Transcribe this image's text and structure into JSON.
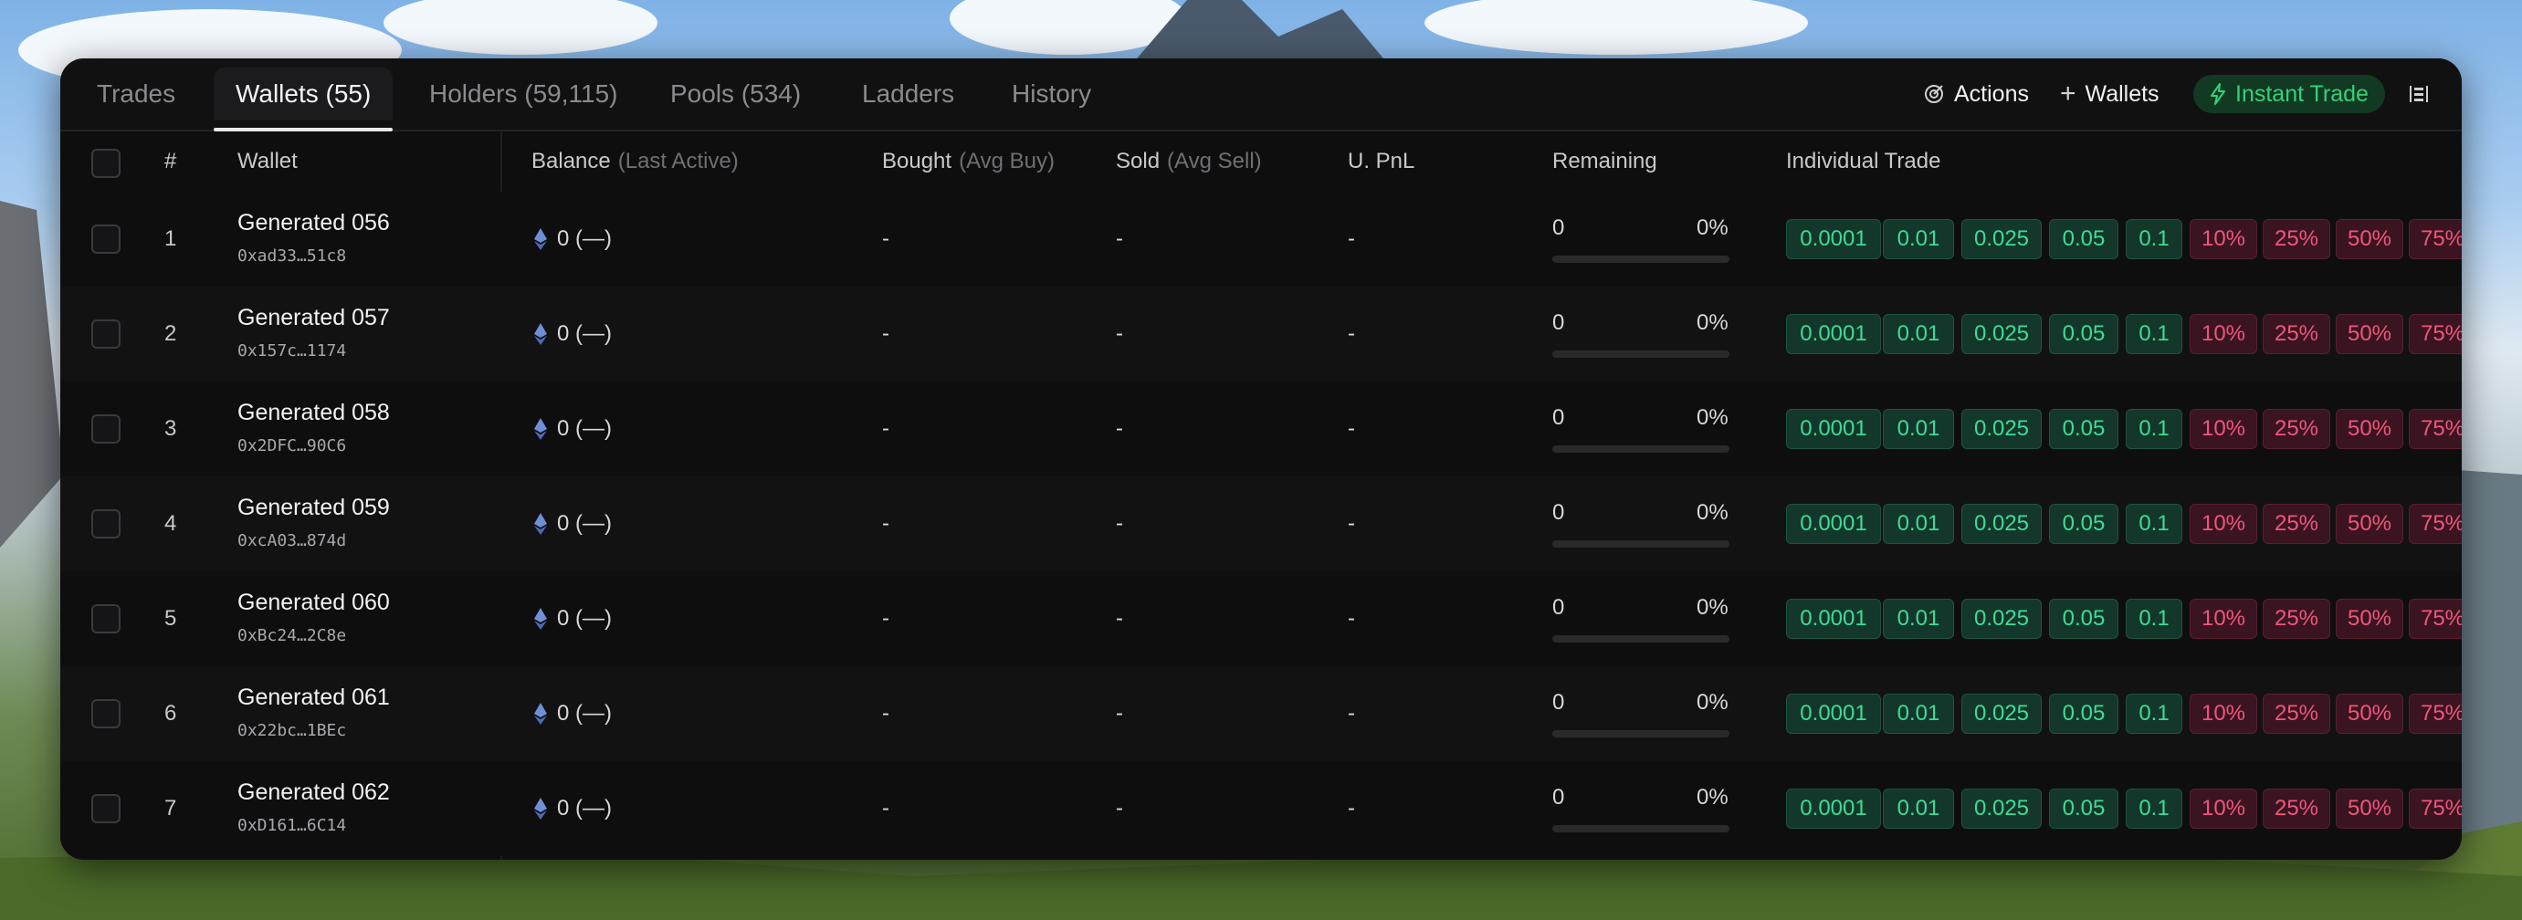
{
  "tabs": [
    {
      "label": "Trades"
    },
    {
      "label": "Wallets (55)"
    },
    {
      "label": "Holders (59,115)"
    },
    {
      "label": "Pools (534)"
    },
    {
      "label": "Ladders"
    },
    {
      "label": "History"
    }
  ],
  "active_tab": "Wallets (55)",
  "toolbar": {
    "actions_label": "Actions",
    "wallets_label": "Wallets",
    "instant_trade_label": "Instant Trade"
  },
  "columns": {
    "index": "#",
    "wallet": "Wallet",
    "balance": "Balance",
    "balance_sub": "(Last Active)",
    "bought": "Bought",
    "bought_sub": "(Avg Buy)",
    "sold": "Sold",
    "sold_sub": "(Avg Sell)",
    "upnl": "U. PnL",
    "remaining": "Remaining",
    "individual_trade": "Individual Trade"
  },
  "buy_amounts": [
    "0.0001",
    "0.01",
    "0.025",
    "0.05",
    "0.1"
  ],
  "sell_percents": [
    "10%",
    "25%",
    "50%",
    "75%"
  ],
  "rows": [
    {
      "index": "1",
      "name": "Generated 056",
      "address": "0xad33…51c8",
      "balance": "0 (—)",
      "bought": "-",
      "sold": "-",
      "upnl": "-",
      "remaining": "0",
      "remaining_pct": "0%",
      "remaining_fraction": 0
    },
    {
      "index": "2",
      "name": "Generated 057",
      "address": "0x157c…1174",
      "balance": "0 (—)",
      "bought": "-",
      "sold": "-",
      "upnl": "-",
      "remaining": "0",
      "remaining_pct": "0%",
      "remaining_fraction": 0
    },
    {
      "index": "3",
      "name": "Generated 058",
      "address": "0x2DFC…90C6",
      "balance": "0 (—)",
      "bought": "-",
      "sold": "-",
      "upnl": "-",
      "remaining": "0",
      "remaining_pct": "0%",
      "remaining_fraction": 0
    },
    {
      "index": "4",
      "name": "Generated 059",
      "address": "0xcA03…874d",
      "balance": "0 (—)",
      "bought": "-",
      "sold": "-",
      "upnl": "-",
      "remaining": "0",
      "remaining_pct": "0%",
      "remaining_fraction": 0
    },
    {
      "index": "5",
      "name": "Generated 060",
      "address": "0xBc24…2C8e",
      "balance": "0 (—)",
      "bought": "-",
      "sold": "-",
      "upnl": "-",
      "remaining": "0",
      "remaining_pct": "0%",
      "remaining_fraction": 0
    },
    {
      "index": "6",
      "name": "Generated 061",
      "address": "0x22bc…1BEc",
      "balance": "0 (—)",
      "bought": "-",
      "sold": "-",
      "upnl": "-",
      "remaining": "0",
      "remaining_pct": "0%",
      "remaining_fraction": 0
    },
    {
      "index": "7",
      "name": "Generated 062",
      "address": "0xD161…6C14",
      "balance": "0 (—)",
      "bought": "-",
      "sold": "-",
      "upnl": "-",
      "remaining": "0",
      "remaining_pct": "0%",
      "remaining_fraction": 0
    }
  ],
  "colors": {
    "panel": "#0e0e0f",
    "buy": "#3ddc97",
    "sell": "#f0557c",
    "instant": "#35d07a",
    "eth": "#6f8fd6"
  },
  "icons": {
    "actions": "target-icon",
    "wallets": "plus-icon",
    "instant_trade": "lightning-icon",
    "settings": "sliders-icon",
    "balance": "ethereum-icon"
  }
}
